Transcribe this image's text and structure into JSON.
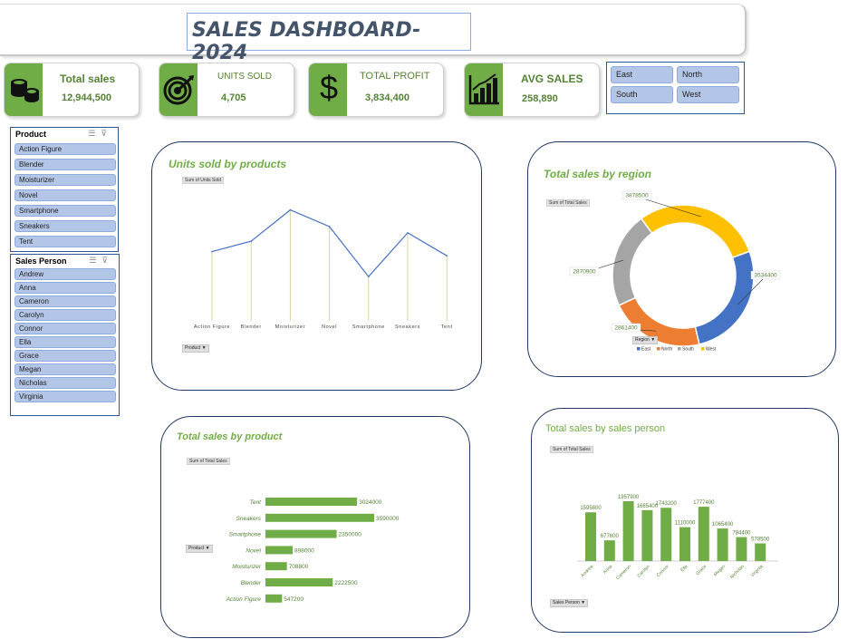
{
  "header": {
    "title": "SALES DASHBOARD- 2024"
  },
  "kpis": [
    {
      "label": "Total sales",
      "value": "12,944,500",
      "icon": "coins-icon"
    },
    {
      "label": "UNITS SOLD",
      "value": "4,705",
      "icon": "target-icon"
    },
    {
      "label": "TOTAL PROFIT",
      "value": "3,834,400",
      "icon": "dollar-icon"
    },
    {
      "label": "AVG SALES",
      "value": "258,890",
      "icon": "bar-growth-icon"
    }
  ],
  "region_slicer": {
    "items": [
      "East",
      "North",
      "South",
      "West"
    ]
  },
  "product_slicer": {
    "title": "Product",
    "items": [
      "Action Figure",
      "Blender",
      "Moisturizer",
      "Novel",
      "Smartphone",
      "Sneakers",
      "Tent"
    ]
  },
  "salesperson_slicer": {
    "title": "Sales Person",
    "items": [
      "Andrew",
      "Anna",
      "Cameron",
      "Carolyn",
      "Connor",
      "Ella",
      "Grace",
      "Megan",
      "Nicholas",
      "Virginia"
    ]
  },
  "panels": {
    "units": {
      "title": "Units sold by products",
      "field": "Sum of Units Sold",
      "filter": "Product"
    },
    "region": {
      "title": "Total sales by region",
      "field": "Sum of Total Sales",
      "filter": "Region"
    },
    "product": {
      "title": "Total sales by product",
      "field": "Sum of Total Sales",
      "filter": "Product"
    },
    "person": {
      "title": "Total sales by sales person",
      "field": "Sum of Total Sales",
      "filter": "Sales Person"
    }
  },
  "colors": {
    "accent": "#70ad47",
    "slicer": "#b4c6e7",
    "east": "#4472c4",
    "north": "#ed7d31",
    "south": "#a5a5a5",
    "west": "#ffc000"
  },
  "chart_data": [
    {
      "type": "line",
      "categories": [
        "Action Figure",
        "Blender",
        "Moisturizer",
        "Novel",
        "Smartphone",
        "Sneakers",
        "Tent"
      ],
      "values": [
        560,
        660,
        960,
        800,
        320,
        740,
        520
      ],
      "title": "Units sold by products"
    },
    {
      "type": "pie",
      "subtype": "donut",
      "categories": [
        "East",
        "North",
        "South",
        "West"
      ],
      "values": [
        3534400,
        2861400,
        2870900,
        3878500
      ],
      "labels": [
        "3534400",
        "2861400",
        "2870900",
        "3878500"
      ],
      "title": "Total sales by region",
      "legend": "bottom"
    },
    {
      "type": "bar",
      "orientation": "horizontal",
      "categories": [
        "Tent",
        "Sneakers",
        "Smartphone",
        "Novel",
        "Moisturizer",
        "Blender",
        "Action Figure"
      ],
      "values": [
        3024000,
        3590000,
        2350000,
        898000,
        708800,
        2222500,
        547200
      ],
      "labels": [
        "3024000",
        "3590000",
        "2350000",
        "898000",
        "708800",
        "2222500",
        "547200"
      ],
      "title": "Total sales by product"
    },
    {
      "type": "bar",
      "categories": [
        "Andrew",
        "Anna",
        "Cameron",
        "Carolyn",
        "Connor",
        "Ella",
        "Grace",
        "Megan",
        "Nicholas",
        "Virginia"
      ],
      "values": [
        1595800,
        677600,
        1957900,
        1665400,
        1743200,
        1110000,
        1777400,
        1065400,
        784400,
        578500
      ],
      "labels": [
        "1595800",
        "677600",
        "1957900",
        "1665400",
        "1743200",
        "1110000",
        "1777400",
        "1065400",
        "784400",
        "578500"
      ],
      "title": "Total sales by sales person"
    }
  ]
}
